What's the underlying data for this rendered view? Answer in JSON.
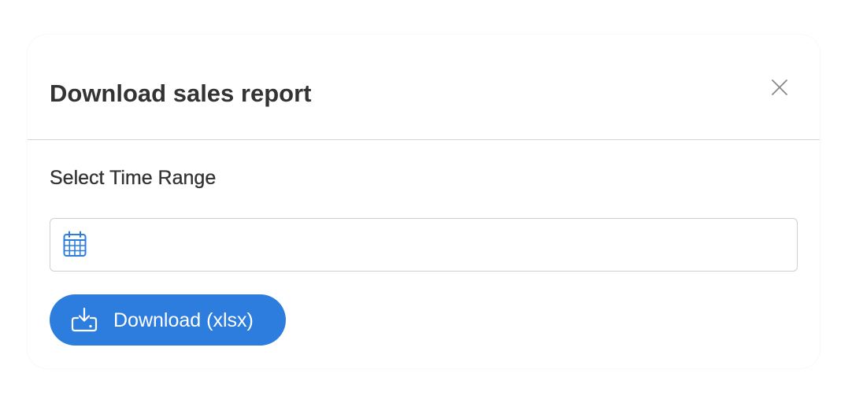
{
  "dialog": {
    "title": "Download sales report",
    "close_icon": "close-icon"
  },
  "time_range": {
    "label": "Select Time Range",
    "value": "",
    "placeholder": "",
    "icon": "calendar-icon"
  },
  "download_button": {
    "label": "Download (xlsx)",
    "icon": "download-icon"
  },
  "colors": {
    "accent": "#2d7ddf",
    "text": "#333333",
    "border": "#cfcfcf",
    "close_icon": "#888888"
  }
}
